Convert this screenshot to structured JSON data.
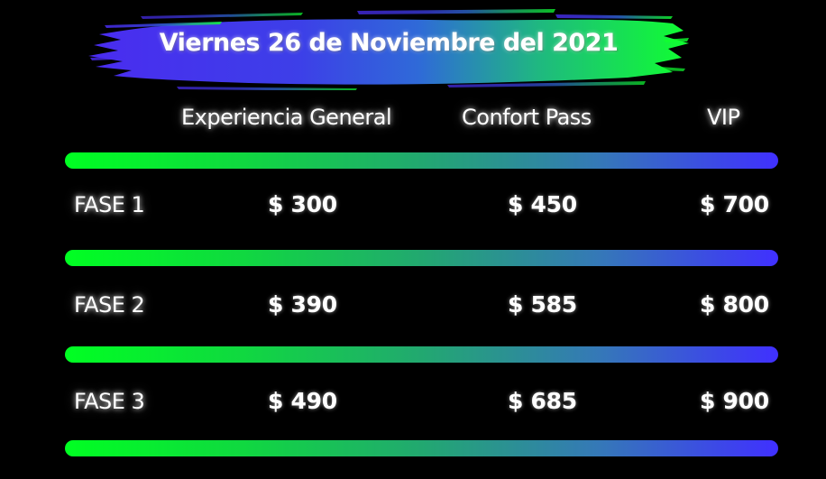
{
  "banner": {
    "title": "Viernes 26 de Noviembre del 2021",
    "gradient_colors": [
      "#4a2cf0",
      "#3a54e0",
      "#10ff30"
    ]
  },
  "columns": [
    "Experiencia General",
    "Confort Pass",
    "VIP"
  ],
  "rows": [
    {
      "phase": "FASE 1",
      "prices": [
        "$ 300",
        "$ 450",
        "$ 700"
      ]
    },
    {
      "phase": "FASE 2",
      "prices": [
        "$ 390",
        "$ 585",
        "$ 800"
      ]
    },
    {
      "phase": "FASE 3",
      "prices": [
        "$ 490",
        "$ 685",
        "$ 900"
      ]
    }
  ],
  "divider_gradient": [
    "#00ff22",
    "#4030ff"
  ]
}
